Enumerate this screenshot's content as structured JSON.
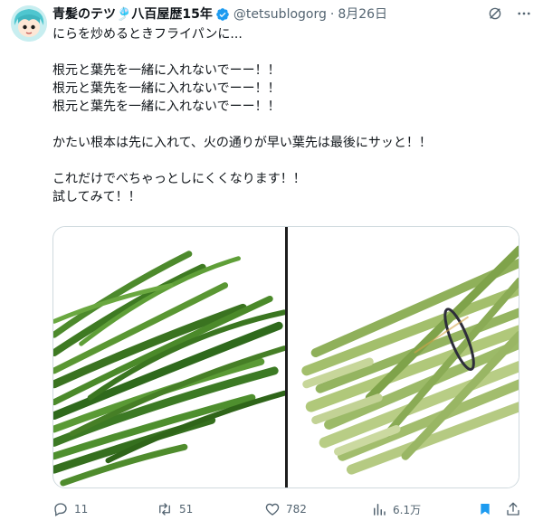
{
  "author": {
    "name": "青髪のテツ🎐八百屋歴15年",
    "handle": "@tetsublogorg",
    "separator": "·",
    "date": "8月26日"
  },
  "tweet": {
    "lines": [
      "にらを炒めるときフライパンに...",
      "",
      "根元と葉先を一緒に入れないでーー！！",
      "根元と葉先を一緒に入れないでーー！！",
      "根元と葉先を一緒に入れないでーー！！",
      "",
      "かたい根本は先に入れて、火の通りが早い葉先は最後にサッと！！",
      "",
      "これだけでべちゃっとしにくくなります！！",
      "試してみて！！"
    ]
  },
  "actions": {
    "replies": "11",
    "retweets": "51",
    "likes": "782",
    "views": "6.1万"
  },
  "colors": {
    "text": "#0f1419",
    "secondary": "#536471",
    "verified": "#1d9bf0",
    "bookmark_active": "#1d9bf0",
    "leaf_green": "#3a7a22",
    "stem_green": "#b8c98a"
  },
  "icons": [
    "verified-badge-icon",
    "grok-icon",
    "more-icon",
    "reply-icon",
    "retweet-icon",
    "like-icon",
    "views-icon",
    "bookmark-icon",
    "share-icon"
  ]
}
